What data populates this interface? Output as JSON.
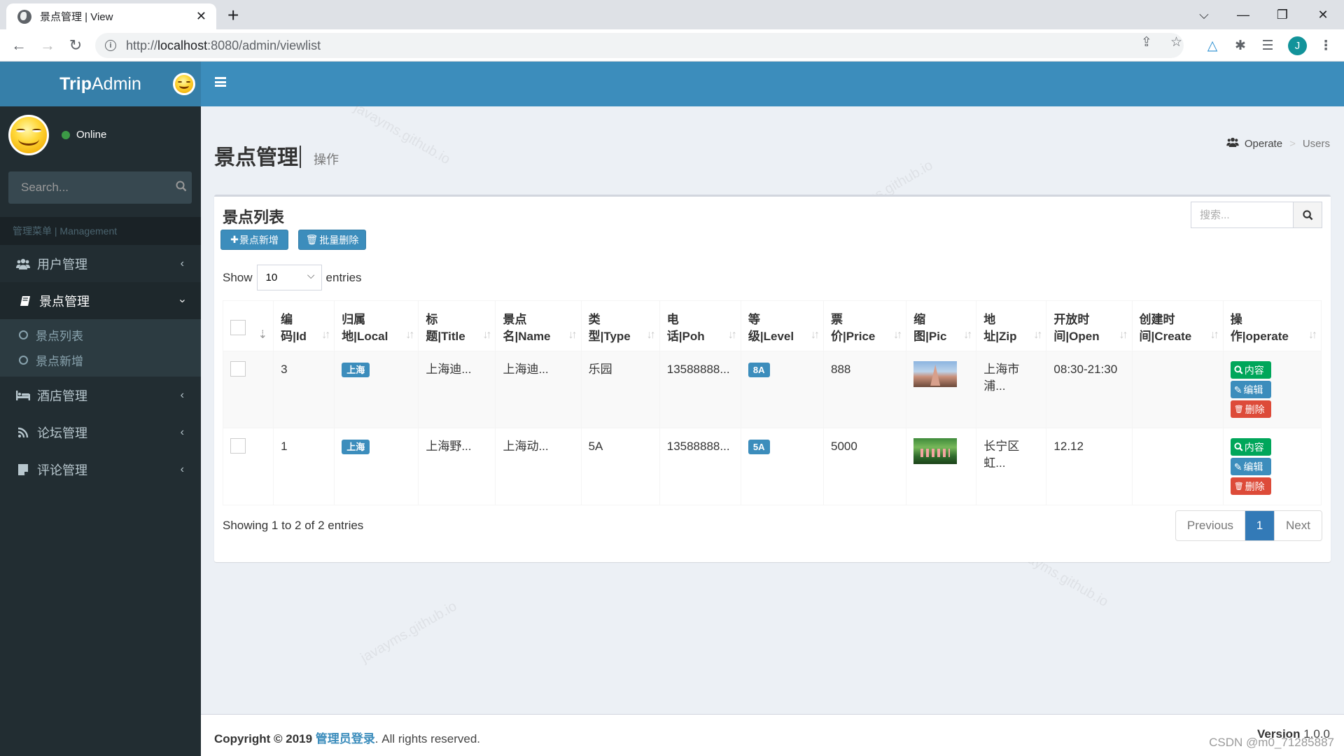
{
  "browser": {
    "tab_title": "景点管理 | View",
    "url_prefix": "http://",
    "url_host": "localhost",
    "url_rest": ":8080/admin/viewlist",
    "profile_initial": "J"
  },
  "app": {
    "logo_bold": "Trip",
    "logo_rest": "Admin"
  },
  "sidebar": {
    "status": "Online",
    "search_placeholder": "Search...",
    "menu_header": "管理菜单 | Management",
    "items": [
      {
        "label": "用户管理",
        "icon": "users-icon"
      },
      {
        "label": "景点管理",
        "icon": "book-icon",
        "active": true,
        "children": [
          {
            "label": "景点列表"
          },
          {
            "label": "景点新增"
          }
        ]
      },
      {
        "label": "酒店管理",
        "icon": "bed-icon"
      },
      {
        "label": "论坛管理",
        "icon": "feed-icon"
      },
      {
        "label": "评论管理",
        "icon": "note-icon"
      }
    ]
  },
  "content": {
    "title": "景点管理",
    "subtitle": "操作",
    "breadcrumb": {
      "home": "Operate",
      "current": "Users"
    }
  },
  "box": {
    "title": "景点列表",
    "add_button": "景点新增",
    "batch_delete_button": "批量删除",
    "search_placeholder": "搜索...",
    "length_label_before": "Show",
    "length_value": "10",
    "length_label_after": "entries"
  },
  "table": {
    "columns": [
      {
        "line1": "编",
        "line2": "码|Id"
      },
      {
        "line1": "归属",
        "line2": "地|Local"
      },
      {
        "line1": "标",
        "line2": "题|Title"
      },
      {
        "line1": "景点",
        "line2": "名|Name"
      },
      {
        "line1": "类",
        "line2": "型|Type"
      },
      {
        "line1": "电",
        "line2": "话|Poh"
      },
      {
        "line1": "等",
        "line2": "级|Level"
      },
      {
        "line1": "票",
        "line2": "价|Price"
      },
      {
        "line1": "缩",
        "line2": "图|Pic"
      },
      {
        "line1": "地",
        "line2": "址|Zip"
      },
      {
        "line1": "开放时",
        "line2": "间|Open"
      },
      {
        "line1": "创建时",
        "line2": "间|Create"
      },
      {
        "line1": "操",
        "line2": "作|operate"
      }
    ],
    "rows": [
      {
        "id": "3",
        "local": "上海",
        "title": "上海迪...",
        "name": "上海迪...",
        "type": "乐园",
        "phone": "13588888...",
        "level": "8A",
        "price": "888",
        "pic": "castle",
        "addr1": "上海市",
        "addr2": "浦...",
        "open": "08:30-21:30",
        "create": ""
      },
      {
        "id": "1",
        "local": "上海",
        "title": "上海野...",
        "name": "上海动...",
        "type": "5A",
        "phone": "13588888...",
        "level": "5A",
        "price": "5000",
        "pic": "flamingo",
        "addr1": "长宁区",
        "addr2": "虹...",
        "open": "12.12",
        "create": ""
      }
    ],
    "ops": {
      "view": "内容",
      "edit": "编辑",
      "delete": "删除"
    }
  },
  "pagination": {
    "info": "Showing 1 to 2 of 2 entries",
    "previous": "Previous",
    "current": "1",
    "next": "Next"
  },
  "footer": {
    "copyright_prefix": "Copyright © 2019",
    "link": "管理员登录",
    "suffix": ". All rights reserved.",
    "version_label": "Version",
    "version": "1.0.0"
  },
  "watermarks": {
    "site": "javayms.github.io",
    "csdn": "CSDN @m0_71285887"
  },
  "colors": {
    "primary": "#3c8dbc",
    "success": "#00a65a",
    "danger": "#dd4b39",
    "sidebar_bg": "#222d32"
  }
}
